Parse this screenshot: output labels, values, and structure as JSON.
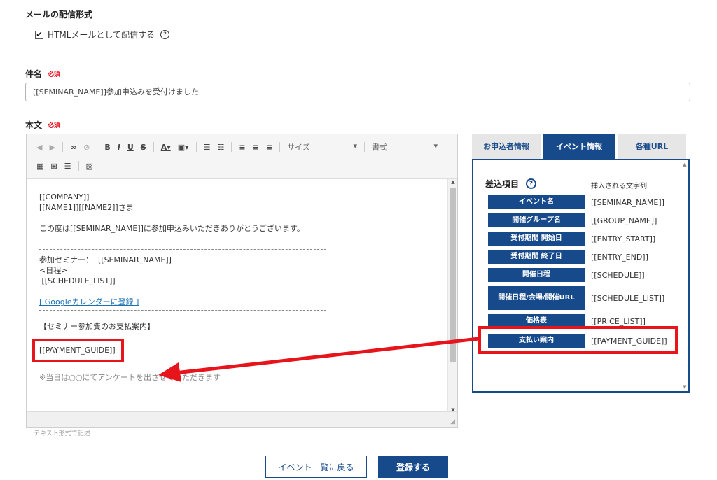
{
  "delivery": {
    "title": "メールの配信形式",
    "html_checkbox_label": "HTMLメールとして配信する",
    "help_icon_glyph": "⑦"
  },
  "subject": {
    "label": "件名",
    "required": "必須",
    "value": "[[SEMINAR_NAME]]参加申込みを受付けました"
  },
  "body": {
    "label": "本文",
    "required": "必須",
    "toolbar": {
      "size_label": "サイズ",
      "format_label": "書式"
    },
    "lines": {
      "company": "[[COMPANY]]",
      "name": "[[NAME1]][[NAME2]]さま",
      "thanks": "この度は[[SEMINAR_NAME]]に参加申込みいただきありがとうございます。",
      "seminar": "参加セミナー：  [[SEMINAR_NAME]]",
      "schedule_heading": "<日程>",
      "schedule_list": " [[SCHEDULE_LIST]]",
      "calendar_link": "[ Googleカレンダーに登録 ]",
      "payment_heading": "【セミナー参加費のお支払案内】",
      "payment_guide": "[[PAYMENT_GUIDE]]",
      "cut_off": "※当日は○○にてアンケートを出させていただきます"
    },
    "note": "テキスト形式で記述"
  },
  "panel": {
    "tabs": [
      {
        "label": "お申込者情報",
        "active": false
      },
      {
        "label": "イベント情報",
        "active": true
      },
      {
        "label": "各種URL",
        "active": false
      }
    ],
    "heading": "差込項目",
    "column_label": "挿入される文字列",
    "variables": [
      {
        "label": "イベント名",
        "code": "[[SEMINAR_NAME]]"
      },
      {
        "label": "開催グループ名",
        "code": "[[GROUP_NAME]]"
      },
      {
        "label": "受付期間 開始日",
        "code": "[[ENTRY_START]]"
      },
      {
        "label": "受付期間 終了日",
        "code": "[[ENTRY_END]]"
      },
      {
        "label": "開催日程",
        "code": "[[SCHEDULE]]"
      },
      {
        "label": "開催日程/会場/開催URL",
        "code": "[[SCHEDULE_LIST]]"
      },
      {
        "label": "価格表",
        "code": "[[PRICE_LIST]]"
      },
      {
        "label": "支払い案内",
        "code": "[[PAYMENT_GUIDE]]"
      }
    ]
  },
  "buttons": {
    "back": "イベント一覧に戻る",
    "save": "登録する"
  },
  "colors": {
    "brand": "#174a8b",
    "highlight": "#e8141b",
    "required": "#e60012"
  }
}
